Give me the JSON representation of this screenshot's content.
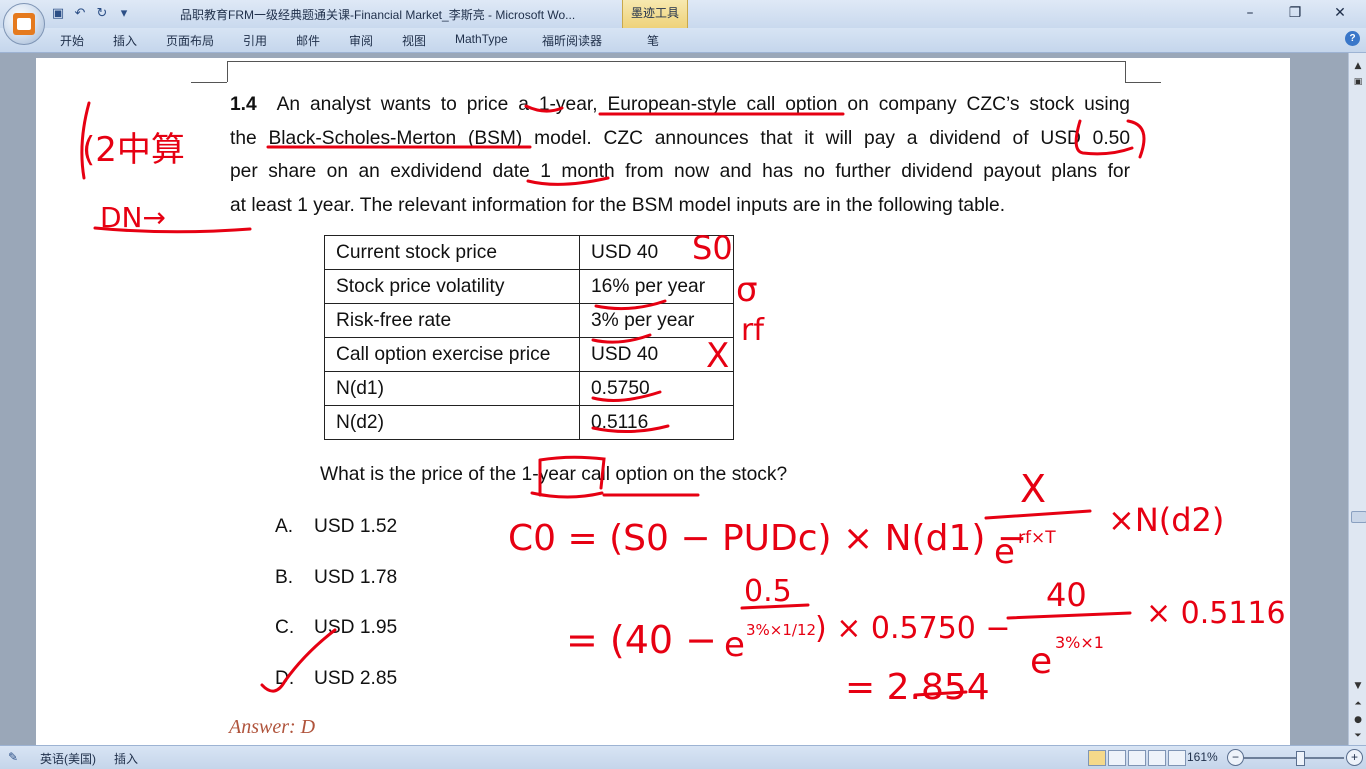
{
  "window": {
    "title": "品职教育FRM一级经典题通关课-Financial Market_李斯亮 - Microsoft Wo...",
    "contextual_tab": "墨迹工具",
    "controls": {
      "minimize": "–",
      "restore": "❐",
      "close": "✕"
    }
  },
  "quick_access": {
    "icons": [
      "save-icon",
      "undo-icon",
      "redo-icon",
      "customize-icon"
    ]
  },
  "ribbon": {
    "tabs": [
      "开始",
      "插入",
      "页面布局",
      "引用",
      "邮件",
      "审阅",
      "视图",
      "MathType",
      "福昕阅读器",
      "笔"
    ],
    "help": "?"
  },
  "document": {
    "question_number": "1.4",
    "paragraph_lines": [
      "An analyst wants to price a 1-year, European-style call option on company CZC’s stock using",
      "the Black-Scholes-Merton (BSM) model. CZC announces that it will pay a dividend of USD 0.50",
      "per share on an exdividend date 1 month from now and has no further dividend payout plans for",
      "at least 1 year. The relevant information for the BSM model inputs are in the following table."
    ],
    "table": [
      {
        "label": "Current stock price",
        "value": "USD 40"
      },
      {
        "label": "Stock price volatility",
        "value": "16% per year"
      },
      {
        "label": "Risk-free rate",
        "value": "3% per year"
      },
      {
        "label": "Call option exercise price",
        "value": "USD 40"
      },
      {
        "label": "N(d1)",
        "value": "0.5750"
      },
      {
        "label": "N(d2)",
        "value": "0.5116"
      }
    ],
    "question": "What is the price of the 1-year call option on the stock?",
    "options": [
      {
        "letter": "A.",
        "text": "USD 1.52"
      },
      {
        "letter": "B.",
        "text": "USD 1.78"
      },
      {
        "letter": "C.",
        "text": "USD 1.95"
      },
      {
        "letter": "D.",
        "text": "USD 2.85"
      }
    ],
    "answer": "Answer: D"
  },
  "ink_annotations": {
    "top_left": "(2中算",
    "top_left_2": "DN→",
    "s0": "S0",
    "sigma": "σ",
    "rf": "rf",
    "x": "X",
    "formula_c0": "C0 = (S0 − PUDc) × N(d1) −",
    "formula_x": "X",
    "formula_den": "e",
    "formula_exp": "rf×T",
    "formula_tail": "×N(d2)",
    "line2_eq": "= (40 −",
    "line2_num": "0.5",
    "line2_den": "e",
    "line2_exp": "3%×1/12",
    "line2_mid": ") × 0.5750 −",
    "line2_num2": "40",
    "line2_den2": "e",
    "line2_exp2": "3%×1",
    "line2_tail": "× 0.5116",
    "result": "= 2.854"
  },
  "statusbar": {
    "language": "英语(美国)",
    "insert": "插入",
    "zoom": "161%",
    "zoom_out": "−",
    "zoom_in": "+"
  }
}
